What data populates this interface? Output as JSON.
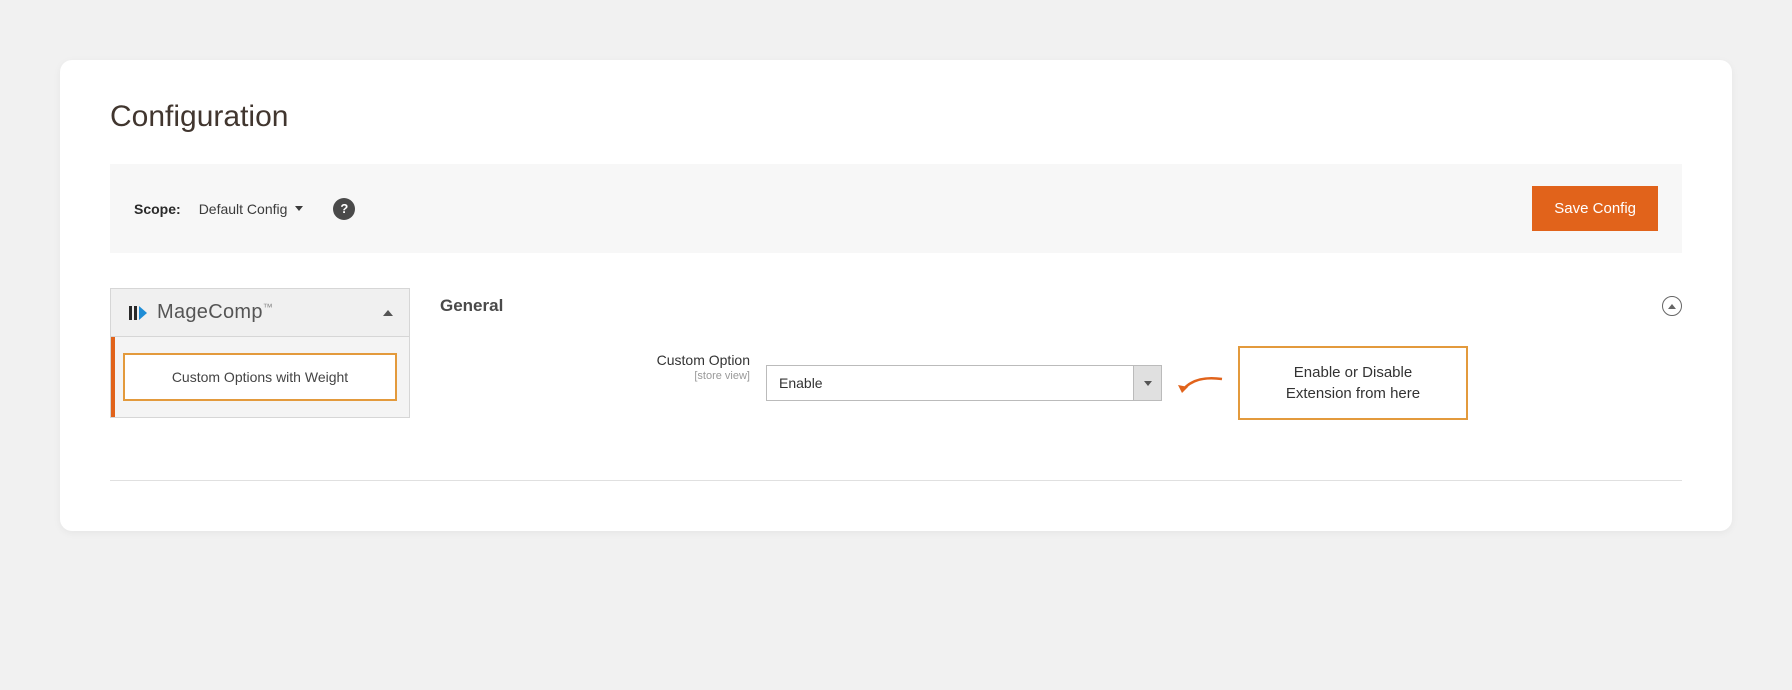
{
  "page": {
    "title": "Configuration"
  },
  "scopeBar": {
    "label": "Scope:",
    "value": "Default Config",
    "saveButton": "Save Config"
  },
  "sidebar": {
    "brand": "MageComp",
    "tm": "™",
    "item": "Custom Options with Weight"
  },
  "section": {
    "title": "General"
  },
  "field": {
    "label": "Custom Option",
    "scope": "[store view]",
    "value": "Enable"
  },
  "annotation": {
    "text": "Enable or Disable Extension from here"
  }
}
